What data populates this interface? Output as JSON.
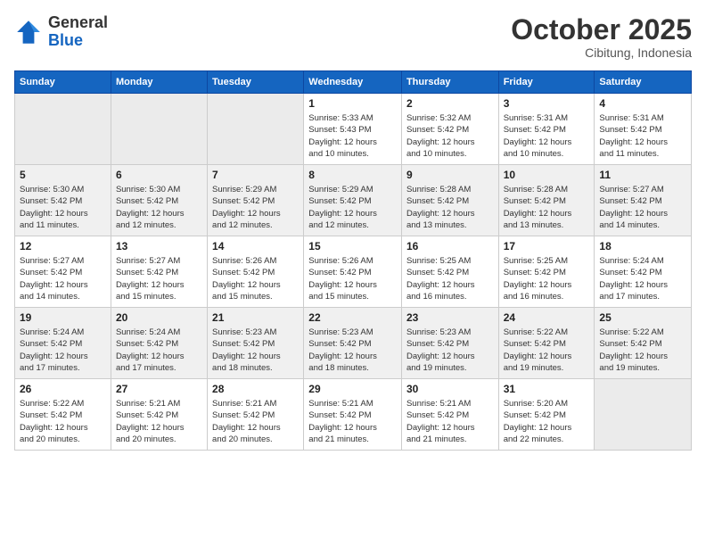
{
  "header": {
    "logo_general": "General",
    "logo_blue": "Blue",
    "month_title": "October 2025",
    "subtitle": "Cibitung, Indonesia"
  },
  "weekdays": [
    "Sunday",
    "Monday",
    "Tuesday",
    "Wednesday",
    "Thursday",
    "Friday",
    "Saturday"
  ],
  "weeks": [
    {
      "row_class": "week-row-1",
      "days": [
        {
          "num": "",
          "empty": true
        },
        {
          "num": "",
          "empty": true
        },
        {
          "num": "",
          "empty": true
        },
        {
          "num": "1",
          "info": "Sunrise: 5:33 AM\nSunset: 5:43 PM\nDaylight: 12 hours\nand 10 minutes."
        },
        {
          "num": "2",
          "info": "Sunrise: 5:32 AM\nSunset: 5:42 PM\nDaylight: 12 hours\nand 10 minutes."
        },
        {
          "num": "3",
          "info": "Sunrise: 5:31 AM\nSunset: 5:42 PM\nDaylight: 12 hours\nand 10 minutes."
        },
        {
          "num": "4",
          "info": "Sunrise: 5:31 AM\nSunset: 5:42 PM\nDaylight: 12 hours\nand 11 minutes."
        }
      ]
    },
    {
      "row_class": "week-row-2",
      "days": [
        {
          "num": "5",
          "info": "Sunrise: 5:30 AM\nSunset: 5:42 PM\nDaylight: 12 hours\nand 11 minutes."
        },
        {
          "num": "6",
          "info": "Sunrise: 5:30 AM\nSunset: 5:42 PM\nDaylight: 12 hours\nand 12 minutes."
        },
        {
          "num": "7",
          "info": "Sunrise: 5:29 AM\nSunset: 5:42 PM\nDaylight: 12 hours\nand 12 minutes."
        },
        {
          "num": "8",
          "info": "Sunrise: 5:29 AM\nSunset: 5:42 PM\nDaylight: 12 hours\nand 12 minutes."
        },
        {
          "num": "9",
          "info": "Sunrise: 5:28 AM\nSunset: 5:42 PM\nDaylight: 12 hours\nand 13 minutes."
        },
        {
          "num": "10",
          "info": "Sunrise: 5:28 AM\nSunset: 5:42 PM\nDaylight: 12 hours\nand 13 minutes."
        },
        {
          "num": "11",
          "info": "Sunrise: 5:27 AM\nSunset: 5:42 PM\nDaylight: 12 hours\nand 14 minutes."
        }
      ]
    },
    {
      "row_class": "week-row-3",
      "days": [
        {
          "num": "12",
          "info": "Sunrise: 5:27 AM\nSunset: 5:42 PM\nDaylight: 12 hours\nand 14 minutes."
        },
        {
          "num": "13",
          "info": "Sunrise: 5:27 AM\nSunset: 5:42 PM\nDaylight: 12 hours\nand 15 minutes."
        },
        {
          "num": "14",
          "info": "Sunrise: 5:26 AM\nSunset: 5:42 PM\nDaylight: 12 hours\nand 15 minutes."
        },
        {
          "num": "15",
          "info": "Sunrise: 5:26 AM\nSunset: 5:42 PM\nDaylight: 12 hours\nand 15 minutes."
        },
        {
          "num": "16",
          "info": "Sunrise: 5:25 AM\nSunset: 5:42 PM\nDaylight: 12 hours\nand 16 minutes."
        },
        {
          "num": "17",
          "info": "Sunrise: 5:25 AM\nSunset: 5:42 PM\nDaylight: 12 hours\nand 16 minutes."
        },
        {
          "num": "18",
          "info": "Sunrise: 5:24 AM\nSunset: 5:42 PM\nDaylight: 12 hours\nand 17 minutes."
        }
      ]
    },
    {
      "row_class": "week-row-4",
      "days": [
        {
          "num": "19",
          "info": "Sunrise: 5:24 AM\nSunset: 5:42 PM\nDaylight: 12 hours\nand 17 minutes."
        },
        {
          "num": "20",
          "info": "Sunrise: 5:24 AM\nSunset: 5:42 PM\nDaylight: 12 hours\nand 17 minutes."
        },
        {
          "num": "21",
          "info": "Sunrise: 5:23 AM\nSunset: 5:42 PM\nDaylight: 12 hours\nand 18 minutes."
        },
        {
          "num": "22",
          "info": "Sunrise: 5:23 AM\nSunset: 5:42 PM\nDaylight: 12 hours\nand 18 minutes."
        },
        {
          "num": "23",
          "info": "Sunrise: 5:23 AM\nSunset: 5:42 PM\nDaylight: 12 hours\nand 19 minutes."
        },
        {
          "num": "24",
          "info": "Sunrise: 5:22 AM\nSunset: 5:42 PM\nDaylight: 12 hours\nand 19 minutes."
        },
        {
          "num": "25",
          "info": "Sunrise: 5:22 AM\nSunset: 5:42 PM\nDaylight: 12 hours\nand 19 minutes."
        }
      ]
    },
    {
      "row_class": "week-row-5",
      "days": [
        {
          "num": "26",
          "info": "Sunrise: 5:22 AM\nSunset: 5:42 PM\nDaylight: 12 hours\nand 20 minutes."
        },
        {
          "num": "27",
          "info": "Sunrise: 5:21 AM\nSunset: 5:42 PM\nDaylight: 12 hours\nand 20 minutes."
        },
        {
          "num": "28",
          "info": "Sunrise: 5:21 AM\nSunset: 5:42 PM\nDaylight: 12 hours\nand 20 minutes."
        },
        {
          "num": "29",
          "info": "Sunrise: 5:21 AM\nSunset: 5:42 PM\nDaylight: 12 hours\nand 21 minutes."
        },
        {
          "num": "30",
          "info": "Sunrise: 5:21 AM\nSunset: 5:42 PM\nDaylight: 12 hours\nand 21 minutes."
        },
        {
          "num": "31",
          "info": "Sunrise: 5:20 AM\nSunset: 5:42 PM\nDaylight: 12 hours\nand 22 minutes."
        },
        {
          "num": "",
          "empty": true
        }
      ]
    }
  ]
}
